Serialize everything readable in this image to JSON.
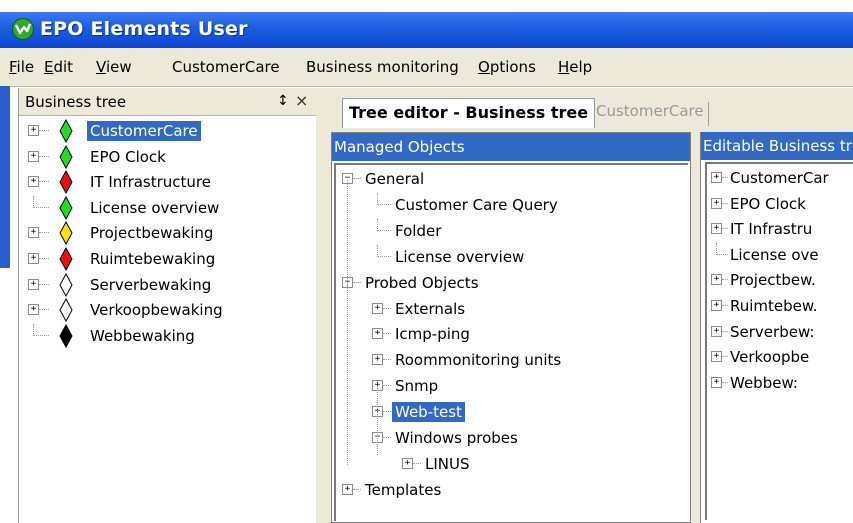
{
  "app": {
    "title": "EPO Elements User",
    "title_bar_color": "#0b46d4"
  },
  "menu": [
    "File",
    "Edit",
    "View",
    "CustomerCare",
    "Business monitoring",
    "Options",
    "Help"
  ],
  "menu_accel": [
    "F",
    "E",
    "V",
    "",
    "",
    "O",
    "H"
  ],
  "left_pane": {
    "title": "Business tree",
    "pin_glyph": "↕",
    "close_glyph": "×",
    "items": [
      {
        "label": "CustomerCare",
        "status": "green",
        "expander": "+",
        "selected": true
      },
      {
        "label": "EPO Clock",
        "status": "green",
        "expander": "+"
      },
      {
        "label": "IT Infrastructure",
        "status": "red",
        "expander": "+"
      },
      {
        "label": "License overview",
        "status": "green",
        "expander": ""
      },
      {
        "label": "Projectbewaking",
        "status": "yellow",
        "expander": "+"
      },
      {
        "label": "Ruimtebewaking",
        "status": "red",
        "expander": "+"
      },
      {
        "label": "Serverbewaking",
        "status": "white",
        "expander": "+"
      },
      {
        "label": "Verkoopbewaking",
        "status": "white",
        "expander": "+"
      },
      {
        "label": "Webbewaking",
        "status": "black",
        "expander": ""
      }
    ],
    "status_colors": {
      "green": "#22dd22",
      "red": "#e81010",
      "yellow": "#ffe000",
      "white": "#ffffff",
      "black": "#000000"
    }
  },
  "tabs": {
    "active": "Tree editor - Business tree",
    "inactive": "CustomerCare"
  },
  "managed_objects": {
    "header": "Managed Objects",
    "tree": [
      {
        "label": "General",
        "level": 0,
        "expander": "−"
      },
      {
        "label": "Customer Care Query",
        "level": 1,
        "expander": ""
      },
      {
        "label": "Folder",
        "level": 1,
        "expander": ""
      },
      {
        "label": "License overview",
        "level": 1,
        "expander": ""
      },
      {
        "label": "Probed Objects",
        "level": 0,
        "expander": "−"
      },
      {
        "label": "Externals",
        "level": 1,
        "expander": "+"
      },
      {
        "label": "Icmp-ping",
        "level": 1,
        "expander": "+"
      },
      {
        "label": "Roommonitoring units",
        "level": 1,
        "expander": "+"
      },
      {
        "label": "Snmp",
        "level": 1,
        "expander": "+"
      },
      {
        "label": "Web-test",
        "level": 1,
        "expander": "+",
        "selected": true
      },
      {
        "label": "Windows probes",
        "level": 1,
        "expander": "−"
      },
      {
        "label": "LINUS",
        "level": 2,
        "expander": "+"
      },
      {
        "label": "Templates",
        "level": 0,
        "expander": "+"
      }
    ],
    "selection_color": "#316ac5"
  },
  "editable_tree": {
    "header": "Editable Business tr",
    "items": [
      {
        "label": "CustomerCar",
        "expander": "+"
      },
      {
        "label": "EPO Clock",
        "expander": "+"
      },
      {
        "label": "IT Infrastru",
        "expander": "+"
      },
      {
        "label": "License ove",
        "expander": ""
      },
      {
        "label": "Projectbew.",
        "expander": "+"
      },
      {
        "label": "Ruimtebew.",
        "expander": "+"
      },
      {
        "label": "Serverbew:",
        "expander": "+"
      },
      {
        "label": "Verkoopbe",
        "expander": "+"
      },
      {
        "label": "Webbew:",
        "expander": "+"
      }
    ]
  }
}
